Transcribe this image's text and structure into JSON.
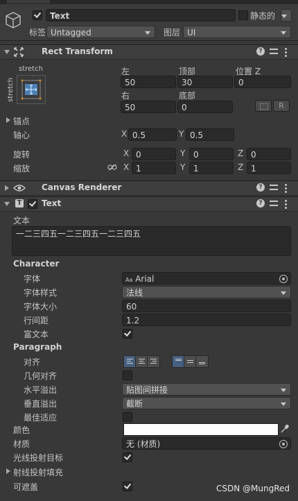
{
  "header": {
    "object_name": "Text",
    "static_label": "静态的",
    "tag_label": "标签",
    "tag_value": "Untagged",
    "layer_label": "图层",
    "layer_value": "UI"
  },
  "rect_transform": {
    "title": "Rect Transform",
    "anchor_preset_top": "stretch",
    "anchor_preset_side": "stretch",
    "left_label": "左",
    "left_value": "50",
    "top_label": "顶部",
    "top_value": "30",
    "posz_label": "位置 Z",
    "posz_value": "0",
    "right_label": "右",
    "right_value": "50",
    "bottom_label": "底部",
    "bottom_value": "0",
    "r_button": "R",
    "anchors_label": "锚点",
    "pivot_label": "轴心",
    "pivot_x": "0.5",
    "pivot_y": "0.5",
    "rotation_label": "旋转",
    "rotation_x": "0",
    "rotation_y": "0",
    "rotation_z": "0",
    "scale_label": "缩放",
    "scale_x": "1",
    "scale_y": "1",
    "scale_z": "1",
    "axis_x": "X",
    "axis_y": "Y",
    "axis_z": "Z"
  },
  "canvas_renderer": {
    "title": "Canvas Renderer"
  },
  "text_component": {
    "title": "Text",
    "text_label": "文本",
    "text_value": "一二三四五一二三四五一二三四五",
    "character_header": "Character",
    "font_label": "字体",
    "font_icon": "Aa",
    "font_value": "Arial",
    "font_style_label": "字体样式",
    "font_style_value": "法线",
    "font_size_label": "字体大小",
    "font_size_value": "60",
    "line_spacing_label": "行间距",
    "line_spacing_value": "1.2",
    "rich_text_label": "富文本",
    "paragraph_header": "Paragraph",
    "alignment_label": "对齐",
    "align_by_geometry_label": "几何对齐",
    "horizontal_overflow_label": "水平溢出",
    "horizontal_overflow_value": "贴图间拼接",
    "vertical_overflow_label": "垂直溢出",
    "vertical_overflow_value": "截断",
    "best_fit_label": "最佳适应",
    "color_label": "颜色",
    "color_value": "#ffffff",
    "material_label": "材质",
    "material_value": "无 (材质)",
    "raycast_target_label": "光线投射目标",
    "raycast_padding_label": "射线投射填充",
    "maskable_label": "可遮盖"
  },
  "watermark": "CSDN @MungRed"
}
